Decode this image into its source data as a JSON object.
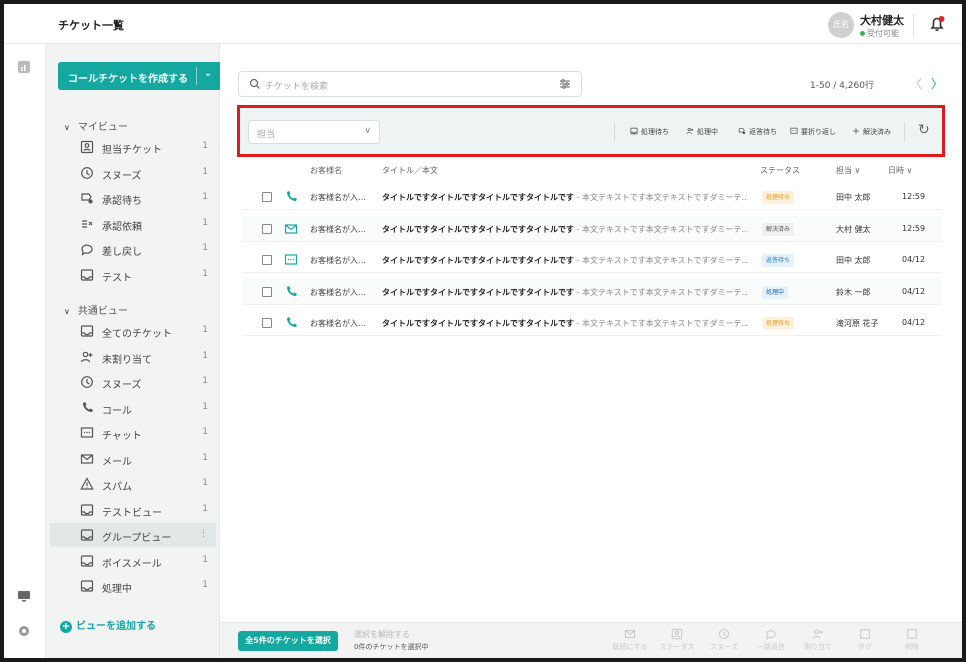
{
  "header": {
    "title": "チケット一覧",
    "avatar_text": "氏名",
    "user_name": "大村健太",
    "user_status": "受付可能"
  },
  "sidebar": {
    "create_button": "コールチケットを作成する",
    "my_view_label": "マイビュー",
    "my_view_items": [
      {
        "label": "担当チケット",
        "count": "1",
        "icon": "assigned-ticket-icon"
      },
      {
        "label": "スヌーズ",
        "count": "1",
        "icon": "clock-icon"
      },
      {
        "label": "承認待ち",
        "count": "1",
        "icon": "approval-pending-icon"
      },
      {
        "label": "承認依頼",
        "count": "1",
        "icon": "approval-request-icon"
      },
      {
        "label": "差し戻し",
        "count": "1",
        "icon": "send-back-icon"
      },
      {
        "label": "テスト",
        "count": "1",
        "icon": "inbox-icon"
      }
    ],
    "shared_view_label": "共通ビュー",
    "shared_view_items": [
      {
        "label": "全てのチケット",
        "count": "1",
        "icon": "inbox-icon"
      },
      {
        "label": "未割り当て",
        "count": "1",
        "icon": "person-add-icon"
      },
      {
        "label": "スヌーズ",
        "count": "1",
        "icon": "clock-icon"
      },
      {
        "label": "コール",
        "count": "1",
        "icon": "phone-icon"
      },
      {
        "label": "チャット",
        "count": "1",
        "icon": "chat-icon"
      },
      {
        "label": "メール",
        "count": "1",
        "icon": "mail-icon"
      },
      {
        "label": "スパム",
        "count": "1",
        "icon": "warning-icon"
      },
      {
        "label": "テストビュー",
        "count": "1",
        "icon": "inbox-icon"
      },
      {
        "label": "グループビュー",
        "count": "⋮",
        "icon": "inbox-icon"
      },
      {
        "label": "ボイスメール",
        "count": "1",
        "icon": "inbox-icon"
      },
      {
        "label": "処理中",
        "count": "1",
        "icon": "inbox-icon"
      }
    ],
    "add_view": "ビューを追加する"
  },
  "search": {
    "placeholder": "チケットを検索"
  },
  "pager": {
    "range": "1-50 / 4,260行"
  },
  "toolbar": {
    "assignee_placeholder": "担当",
    "items": [
      "処理待ち",
      "処理中",
      "返答待ち",
      "要折り返し",
      "解決済み"
    ]
  },
  "columns": {
    "customer": "お客様名",
    "title": "タイトル／本文",
    "status": "ステータス",
    "assignee": "担当 ∨",
    "date": "日時 ∨"
  },
  "tickets": [
    {
      "channel": "phone-icon",
      "customer": "お客様名が入…",
      "title": "タイトルですタイトルですタイトルですタイトルです",
      "body": " - 本文テキストです本文テキストですダミーテ…",
      "status": "処理待ち",
      "assignee": "田中 太郎",
      "date": "12:59"
    },
    {
      "channel": "mail-icon",
      "customer": "お客様名が入…",
      "title": "タイトルですタイトルですタイトルですタイトルです",
      "body": " - 本文テキストです本文テキストですダミーテ…",
      "status": "解決済み",
      "assignee": "大村 健太",
      "date": "12:59"
    },
    {
      "channel": "chat-icon",
      "customer": "お客様名が入…",
      "title": "タイトルですタイトルですタイトルですタイトルです",
      "body": " - 本文テキストです本文テキストですダミーテ…",
      "status": "返答待ち",
      "assignee": "田中 太郎",
      "date": "04/12"
    },
    {
      "channel": "phone-icon",
      "customer": "お客様名が入…",
      "title": "タイトルですタイトルですタイトルですタイトルです",
      "body": " - 本文テキストです本文テキストですダミーテ…",
      "status": "処理中",
      "assignee": "鈴木 一郎",
      "date": "04/12"
    },
    {
      "channel": "phone-icon",
      "customer": "お客様名が入…",
      "title": "タイトルですタイトルですタイトルですタイトルです",
      "body": " - 本文テキストです本文テキストですダミーテ…",
      "status": "処理待ち",
      "assignee": "滝河原 花子",
      "date": "04/12"
    }
  ],
  "bottom": {
    "select_all": "全5件のチケットを選択",
    "deselect": "選択を解除する",
    "selected_info": "0件のチケットを選択中",
    "actions": [
      "既読にする",
      "ステータス",
      "スヌーズ",
      "一括返信",
      "割り当て",
      "タグ",
      "削除"
    ]
  },
  "colors": {
    "accent": "#14a8a0",
    "highlight_box": "#e01b1b",
    "status_waiting_bg": "#fdf1df",
    "status_waiting_fg": "#e69500"
  }
}
